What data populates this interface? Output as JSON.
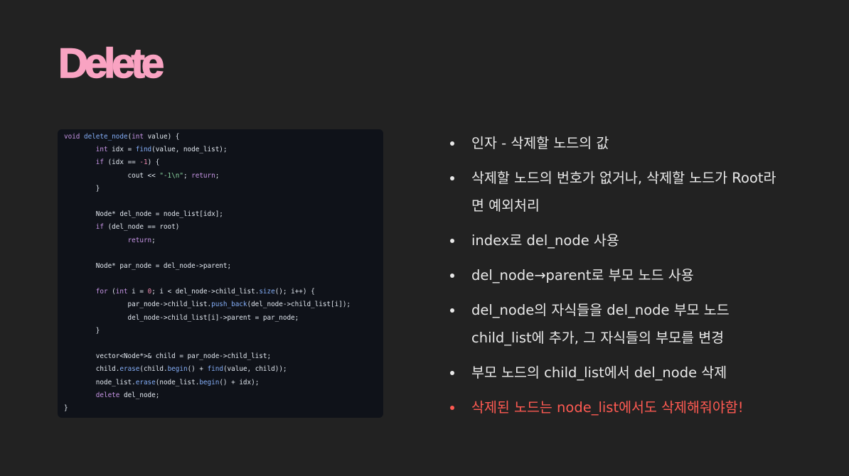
{
  "slide": {
    "title": "Delete"
  },
  "code": {
    "lines": [
      [
        [
          "kw",
          "void"
        ],
        [
          "t",
          " "
        ],
        [
          "fn",
          "delete_node"
        ],
        [
          "t",
          "("
        ],
        [
          "kw",
          "int"
        ],
        [
          "t",
          " value) {"
        ]
      ],
      [
        [
          "t",
          "        "
        ],
        [
          "kw",
          "int"
        ],
        [
          "t",
          " idx = "
        ],
        [
          "fn",
          "find"
        ],
        [
          "t",
          "(value, node_list);"
        ]
      ],
      [
        [
          "t",
          "        "
        ],
        [
          "kw",
          "if"
        ],
        [
          "t",
          " (idx == "
        ],
        [
          "num",
          "-1"
        ],
        [
          "t",
          ") {"
        ]
      ],
      [
        [
          "t",
          "                cout << "
        ],
        [
          "str",
          "\"-1\\n\""
        ],
        [
          "t",
          "; "
        ],
        [
          "kw",
          "return"
        ],
        [
          "t",
          ";"
        ]
      ],
      [
        [
          "t",
          "        }"
        ]
      ],
      [
        [
          "t",
          ""
        ]
      ],
      [
        [
          "t",
          "        Node* del_node = node_list[idx];"
        ]
      ],
      [
        [
          "t",
          "        "
        ],
        [
          "kw",
          "if"
        ],
        [
          "t",
          " (del_node == root)"
        ]
      ],
      [
        [
          "t",
          "                "
        ],
        [
          "kw",
          "return"
        ],
        [
          "t",
          ";"
        ]
      ],
      [
        [
          "t",
          ""
        ]
      ],
      [
        [
          "t",
          "        Node* par_node = del_node->parent;"
        ]
      ],
      [
        [
          "t",
          ""
        ]
      ],
      [
        [
          "t",
          "        "
        ],
        [
          "kw",
          "for"
        ],
        [
          "t",
          " ("
        ],
        [
          "kw",
          "int"
        ],
        [
          "t",
          " i = "
        ],
        [
          "num",
          "0"
        ],
        [
          "t",
          "; i < del_node->child_list."
        ],
        [
          "fn",
          "size"
        ],
        [
          "t",
          "(); i++) {"
        ]
      ],
      [
        [
          "t",
          "                par_node->child_list."
        ],
        [
          "fn",
          "push_back"
        ],
        [
          "t",
          "(del_node->child_list[i]);"
        ]
      ],
      [
        [
          "t",
          "                del_node->child_list[i]->parent = par_node;"
        ]
      ],
      [
        [
          "t",
          "        }"
        ]
      ],
      [
        [
          "t",
          ""
        ]
      ],
      [
        [
          "t",
          "        vector<Node*>& child = par_node->child_list;"
        ]
      ],
      [
        [
          "t",
          "        child."
        ],
        [
          "fn",
          "erase"
        ],
        [
          "t",
          "(child."
        ],
        [
          "fn",
          "begin"
        ],
        [
          "t",
          "() + "
        ],
        [
          "fn",
          "find"
        ],
        [
          "t",
          "(value, child));"
        ]
      ],
      [
        [
          "t",
          "        node_list."
        ],
        [
          "fn",
          "erase"
        ],
        [
          "t",
          "(node_list."
        ],
        [
          "fn",
          "begin"
        ],
        [
          "t",
          "() + idx);"
        ]
      ],
      [
        [
          "t",
          "        "
        ],
        [
          "kw",
          "delete"
        ],
        [
          "t",
          " del_node;"
        ]
      ],
      [
        [
          "t",
          "}"
        ]
      ]
    ]
  },
  "bullets": [
    {
      "text": "인자 - 삭제할 노드의 값",
      "warn": false
    },
    {
      "text": "삭제할 노드의 번호가 없거나, 삭제할 노드가 Root라\n면 예외처리",
      "warn": false
    },
    {
      "text": "index로 del_node 사용",
      "warn": false
    },
    {
      "text": "del_node→parent로 부모 노드 사용",
      "warn": false
    },
    {
      "text": "del_node의 자식들을 del_node 부모 노드\nchild_list에 추가, 그 자식들의 부모를 변경",
      "warn": false
    },
    {
      "text": "부모 노드의 child_list에서 del_node 삭제",
      "warn": false
    },
    {
      "text": "삭제된 노드는 node_list에서도 삭제해줘야함!",
      "warn": true
    }
  ],
  "colors": {
    "background": "#222222",
    "title": "#f9a3c2",
    "code_background": "#0f1219",
    "bullet_text": "#e9e9e9",
    "warning_text": "#ff5a52"
  }
}
